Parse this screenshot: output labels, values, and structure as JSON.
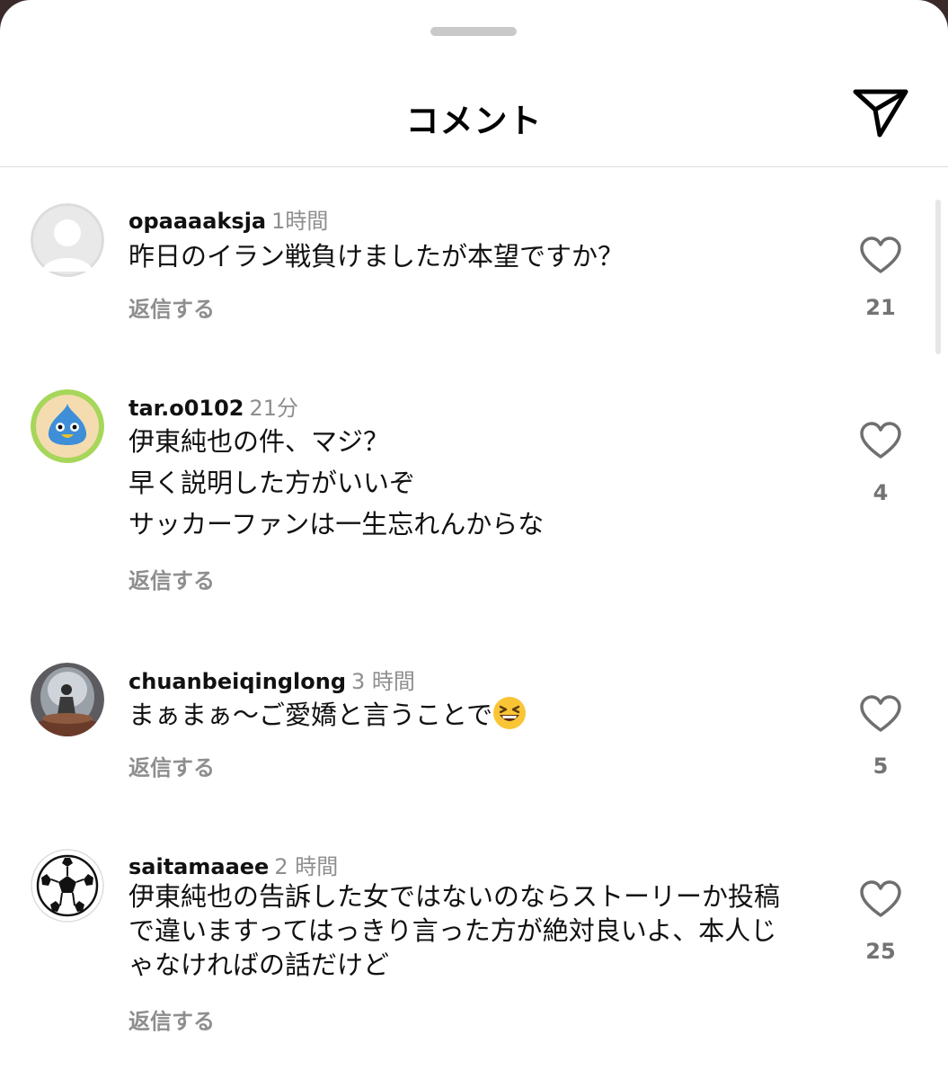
{
  "header": {
    "title": "コメント"
  },
  "comments": [
    {
      "user": "opaaaaksja",
      "time": "1時間",
      "lines": [
        "昨日のイラン戦負けましたが本望ですか？"
      ],
      "reply": "返信する",
      "likes": "21"
    },
    {
      "user": "tar.o0102",
      "time": "21分",
      "lines": [
        "伊東純也の件、マジ？",
        "早く説明した方がいいぞ",
        "サッカーファンは一生忘れんからな"
      ],
      "reply": "返信する",
      "likes": "4"
    },
    {
      "user": "chuanbeiqinglong",
      "time": "3 時間",
      "lines": [
        "まぁまぁ〜ご愛嬌と言うことで"
      ],
      "emoji": "grinning-squinting-face",
      "reply": "返信する",
      "likes": "5"
    },
    {
      "user": "saitamaaee",
      "time": "2 時間",
      "lines": [
        "伊東純也の告訴した女ではないのならストーリーか投稿",
        "で違いますってはっきり言った方が絶対良いよ、本人じ",
        "ゃなければの話だけど"
      ],
      "reply": "返信する",
      "likes": "25"
    }
  ]
}
